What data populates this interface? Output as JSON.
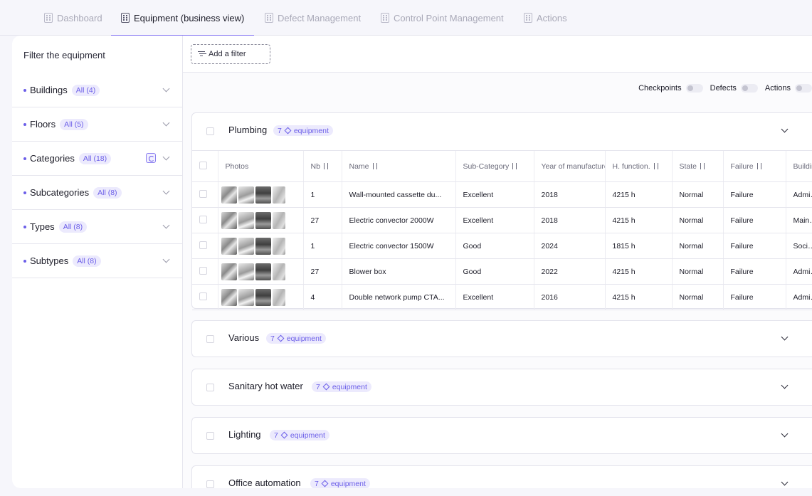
{
  "tabs": [
    {
      "label": "Dashboard",
      "active": false
    },
    {
      "label": "Equipment (business view)",
      "active": true
    },
    {
      "label": "Defect Management",
      "active": false
    },
    {
      "label": "Control Point Management",
      "active": false
    },
    {
      "label": "Actions",
      "active": false
    }
  ],
  "sidebar": {
    "title": "Filter the equipment",
    "filters": [
      {
        "label": "Buildings",
        "pill": "All (4)"
      },
      {
        "label": "Floors",
        "pill": "All (5)"
      },
      {
        "label": "Categories",
        "pill": "All (18)"
      },
      {
        "label": "Subcategories",
        "pill": "All (8)"
      },
      {
        "label": "Types",
        "pill": "All (8)"
      },
      {
        "label": "Subtypes",
        "pill": "All (8)"
      }
    ]
  },
  "main": {
    "add_filter_label": "Add a filter",
    "toggles": [
      {
        "label": "Checkpoints",
        "on": false
      },
      {
        "label": "Defects",
        "on": false
      },
      {
        "label": "Actions",
        "on": false
      }
    ],
    "equipment_word": "equipment",
    "categories": [
      {
        "name": "Plumbing",
        "count": "7",
        "expanded": true
      },
      {
        "name": "Various",
        "count": "7",
        "expanded": false
      },
      {
        "name": "Sanitary hot water",
        "count": "7",
        "expanded": false
      },
      {
        "name": "Lighting",
        "count": "7",
        "expanded": false
      },
      {
        "name": "Office automation",
        "count": "7",
        "expanded": false
      }
    ],
    "table": {
      "headers": [
        "Photos",
        "Nb",
        "Name",
        "Sub-Category",
        "Year of manufacture",
        "H. function.",
        "State",
        "Failure",
        "Building"
      ],
      "rows": [
        [
          "1",
          "Wall-mounted cassette du...",
          "Excellent",
          "2018",
          "4215 h",
          "Normal",
          "Failure",
          "Adminis"
        ],
        [
          "27",
          "Electric convector 2000W",
          "Excellent",
          "2018",
          "4215 h",
          "Normal",
          "Failure",
          "Main wo"
        ],
        [
          "1",
          "Electric convector 1500W",
          "Good",
          "2024",
          "1815 h",
          "Normal",
          "Failure",
          "Social p"
        ],
        [
          "27",
          "Blower box",
          "Good",
          "2022",
          "4215 h",
          "Normal",
          "Failure",
          "Adminis"
        ],
        [
          "4",
          "Double network pump CTA...",
          "Excellent",
          "2016",
          "4215 h",
          "Normal",
          "Failure",
          "Adminis"
        ]
      ]
    }
  }
}
